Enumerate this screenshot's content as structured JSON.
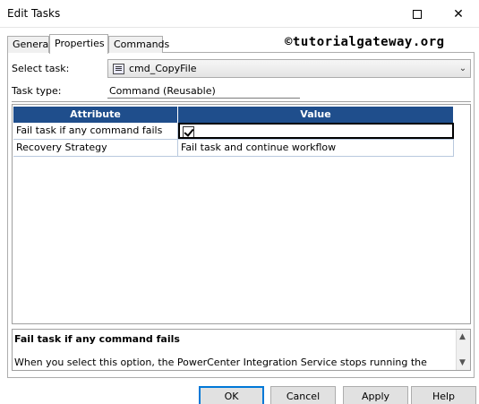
{
  "window": {
    "title": "Edit Tasks"
  },
  "tabs": [
    {
      "label": "General"
    },
    {
      "label": "Properties"
    },
    {
      "label": "Commands"
    }
  ],
  "active_tab": "Properties",
  "watermark": "©tutorialgateway.org",
  "select_task": {
    "label": "Select task:",
    "value": "cmd_CopyFile",
    "icon": "command-task-icon"
  },
  "task_type": {
    "label": "Task type:",
    "value": "Command (Reusable)"
  },
  "grid": {
    "headers": {
      "attribute": "Attribute",
      "value": "Value"
    },
    "rows": [
      {
        "attribute": "Fail task if any command fails",
        "value": "",
        "checked": true
      },
      {
        "attribute": "Recovery Strategy",
        "value": "Fail task and continue workflow"
      }
    ]
  },
  "description": {
    "title": "Fail task if any command fails",
    "text": "When you select this option, the PowerCenter Integration Service stops running the commands and fails the Command task if any command fails. If you do not select this option, the PowerCenter"
  },
  "buttons": {
    "ok": "OK",
    "cancel": "Cancel",
    "apply": "Apply",
    "help": "Help"
  },
  "colors": {
    "grid_header": "#1f4e8c",
    "ok_focus": "#0078d7"
  }
}
